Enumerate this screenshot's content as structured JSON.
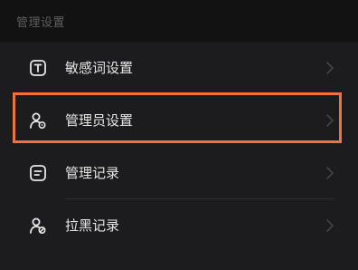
{
  "section": {
    "title": "管理设置"
  },
  "rows": [
    {
      "label": "敏感词设置",
      "icon": "text-t-icon"
    },
    {
      "label": "管理员设置",
      "icon": "admin-user-icon"
    },
    {
      "label": "管理记录",
      "icon": "record-list-icon"
    },
    {
      "label": "拉黑记录",
      "icon": "block-user-icon"
    }
  ],
  "colors": {
    "background": "#1c1c1e",
    "header_background": "#121212",
    "text": "#e6e6e6",
    "muted": "#5e5e62",
    "highlight": "#f0743a"
  },
  "highlighted_row_index": 1
}
